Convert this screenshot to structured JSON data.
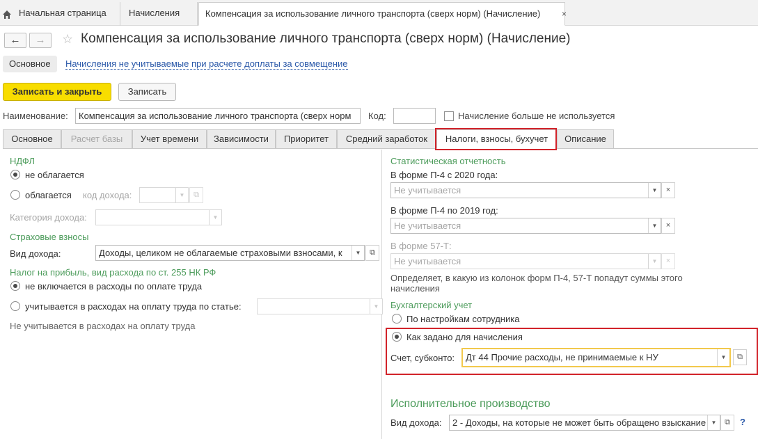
{
  "topbar": {
    "home_tab": "Начальная страница",
    "tab2": "Начисления",
    "tab3": "Компенсация за использование личного транспорта (сверх норм) (Начисление)",
    "close_glyph": "×"
  },
  "header": {
    "back": "←",
    "forward": "→",
    "star": "☆",
    "title": "Компенсация за использование личного транспорта (сверх норм) (Начисление)"
  },
  "sections": {
    "main": "Основное",
    "link": "Начисления не учитываемые при расчете доплаты за совмещение"
  },
  "toolbar": {
    "save_close": "Записать и закрыть",
    "save": "Записать"
  },
  "fields": {
    "name_label": "Наименование:",
    "name_value": "Компенсация за использование личного транспорта (сверх норм",
    "code_label": "Код:",
    "code_value": "",
    "not_used_label": "Начисление больше не используется"
  },
  "tabs": [
    "Основное",
    "Расчет базы",
    "Учет времени",
    "Зависимости",
    "Приоритет",
    "Средний заработок",
    "Налоги, взносы, бухучет",
    "Описание"
  ],
  "ndfl": {
    "header": "НДФЛ",
    "opt1": "не облагается",
    "opt2": "облагается",
    "income_code_label": "код дохода:",
    "income_code_value": "",
    "category_label": "Категория дохода:",
    "category_value": ""
  },
  "insurance": {
    "header": "Страховые взносы",
    "income_type_label": "Вид дохода:",
    "income_type_value": "Доходы, целиком не облагаемые страховыми взносами, к"
  },
  "profit_tax": {
    "header": "Налог на прибыль, вид расхода по ст. 255 НК РФ",
    "opt1": "не включается в расходы по оплате труда",
    "opt2": "учитывается в расходах на оплату труда по статье:",
    "article_value": "",
    "note": "Не учитывается в расходах на оплату труда"
  },
  "stats": {
    "header": "Статистическая отчетность",
    "p4_2020_label": "В форме П-4 с 2020 года:",
    "p4_2020_value": "Не учитывается",
    "p4_2019_label": "В форме П-4 по 2019 год:",
    "p4_2019_value": "Не учитывается",
    "f57t_label": "В форме 57-Т:",
    "f57t_value": "Не учитывается",
    "note": "Определяет, в какую из колонок форм П-4, 57-Т попадут суммы этого начисления"
  },
  "accounting": {
    "header": "Бухгалтерский учет",
    "opt1": "По настройкам сотрудника",
    "opt2": "Как задано для начисления",
    "account_label": "Счет, субконто:",
    "account_value": "Дт 44 Прочие расходы, не принимаемые к НУ"
  },
  "enforcement": {
    "header": "Исполнительное производство",
    "income_type_label": "Вид дохода:",
    "income_type_value": "2 - Доходы, на которые не может быть обращено взыскание (",
    "help": "?"
  },
  "colors": {
    "accent_yellow": "#f8dd00",
    "group_header_green": "#4b9b5a",
    "link_blue": "#2b59a9",
    "highlight_red": "#d2232a"
  }
}
